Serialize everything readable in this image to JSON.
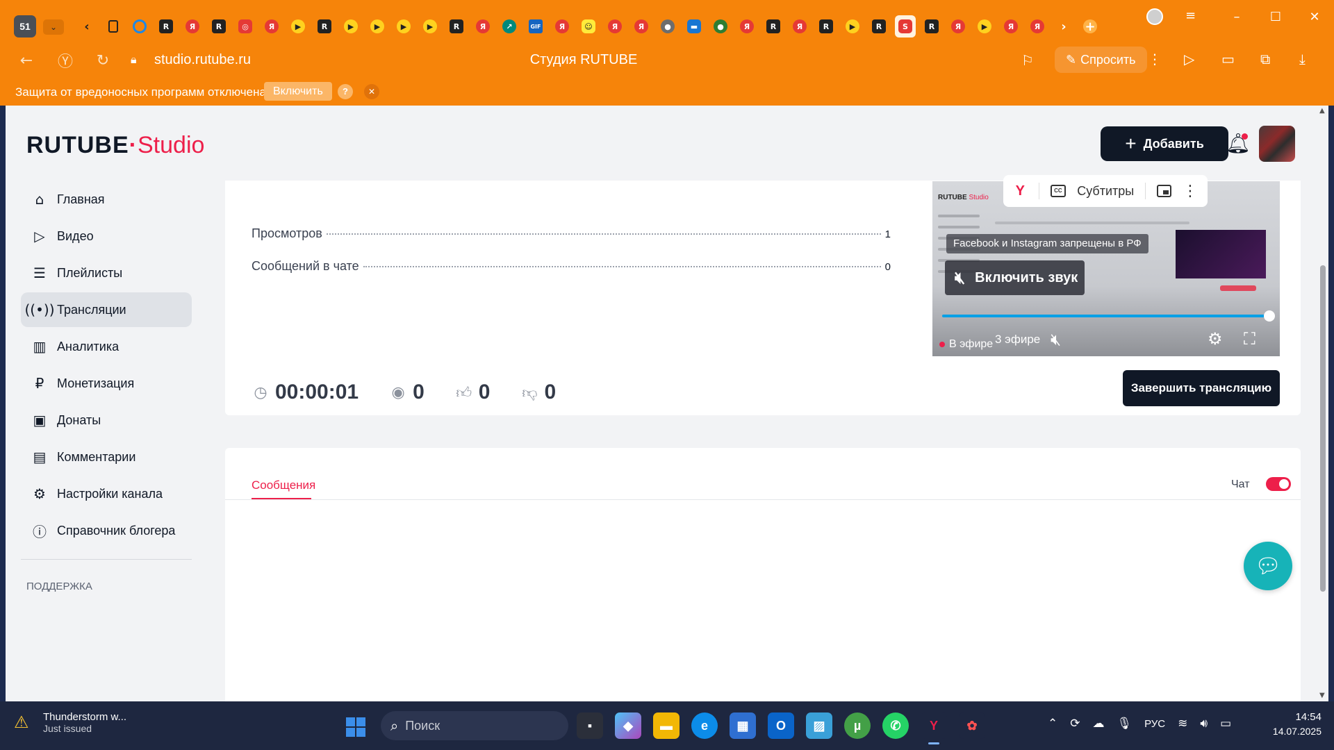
{
  "browser": {
    "tab_count": "51",
    "url": "studio.rutube.ru",
    "page_title": "Студия RUTUBE",
    "ask_label": "Спросить",
    "protection_text": "Защита от вредоносных программ отключена",
    "protection_enable": "Включить",
    "protection_help": "?"
  },
  "header": {
    "logo_main": "RUTUBE",
    "logo_studio": "Studio",
    "add_label": "Добавить"
  },
  "sidebar": {
    "items": [
      {
        "label": "Главная",
        "icon": "home-icon"
      },
      {
        "label": "Видео",
        "icon": "video-icon"
      },
      {
        "label": "Плейлисты",
        "icon": "playlist-icon"
      },
      {
        "label": "Трансляции",
        "icon": "broadcast-icon",
        "active": true
      },
      {
        "label": "Аналитика",
        "icon": "chart-icon"
      },
      {
        "label": "Монетизация",
        "icon": "ruble-icon"
      },
      {
        "label": "Донаты",
        "icon": "wallet-icon"
      },
      {
        "label": "Комментарии",
        "icon": "comment-icon"
      },
      {
        "label": "Настройки канала",
        "icon": "gear-icon"
      },
      {
        "label": "Справочник блогера",
        "icon": "info-icon"
      }
    ],
    "support_heading": "ПОДДЕРЖКА"
  },
  "stats": {
    "views_label": "Просмотров",
    "views_value": "1",
    "chat_label": "Сообщений в чате",
    "chat_value": "0"
  },
  "metrics": {
    "duration": "00:00:01",
    "viewers": "0",
    "likes": "0",
    "dislikes": "0"
  },
  "player": {
    "subtitles_label": "Субтитры",
    "notice": "Facebook и Instagram запрещены в РФ",
    "unmute_label": "Включить звук",
    "live_label": "В эфире",
    "live_label_2": "3 эфире",
    "preview_logo_main": "RUTUBE",
    "preview_logo_studio": "Studio"
  },
  "finish_label": "Завершить трансляцию",
  "chat": {
    "tab_label": "Сообщения",
    "toggle_label": "Чат",
    "toggle_on": true
  },
  "taskbar": {
    "weather_title": "Thunderstorm w...",
    "weather_sub": "Just issued",
    "search_placeholder": "Поиск",
    "lang": "РУС",
    "time": "14:54",
    "date": "14.07.2025"
  }
}
